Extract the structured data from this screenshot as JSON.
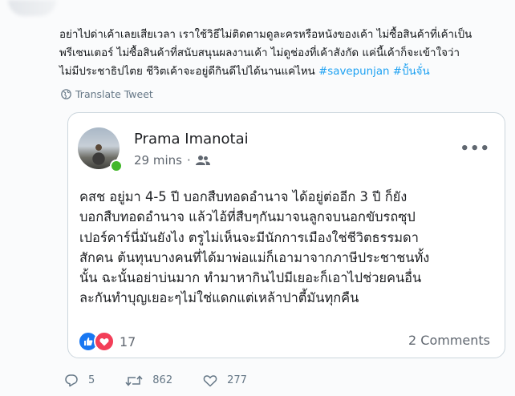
{
  "tweet": {
    "text_line1": "อย่าไปด่าเค้าเลยเสียเวลา เราใช้วิธีไม่ติดตามดูละครหรือหนังของเค้า ไม่ซื้อสินค้าที่เค้าเป็น",
    "text_line2": "พรีเซนเตอร์ ไม่ซื้อสินค้าที่สนับสนุนผลงานเค้า ไม่ดูช่องที่เค้าสังกัด แค่นี้เค้าก็จะเข้าใจว่า",
    "text_line3": "ไม่มีประชาธิปไตย ชีวิตเค้าจะอยู่ดีกินดีไปได้นานแค่ไหน ",
    "hashtag1": "#savepunjan",
    "hashtag2": "#ปั้นจั่น",
    "translate_label": "Translate Tweet"
  },
  "embedded_post": {
    "author": "Prama Imanotai",
    "time": "29 mins",
    "more_label": "•••",
    "body_lines": [
      "คสช อยู่มา 4-5 ปี บอกสืบทอดอำนาจ ได้อยู่ต่ออีก 3 ปี ก็ยัง",
      "บอกสืบทอดอำนาจ แล้วไอ้ที่สืบๆกันมาจนลูกจบนอกขับรถซุป",
      "เปอร์คาร์นี่มันยังไง ตรูไม่เห็นจะมีนักการเมืองใช่ชีวิตธรรมดา",
      "สักคน ต้นทุนบางคนที่ได้มาพ่อแม่ก็เอามาจากภาษีประชาชนทั้ง",
      "นั้น ฉะนั้นอย่าบ่นมาก ทำมาหากินไปมีเยอะก็เอาไปช่วยคนอื่น",
      "ละกันทำบุญเยอะๆไม่ใช่แดกแต่เหล้าปาตี้มันทุกคืน"
    ],
    "reaction_count": "17",
    "comments_label": "2 Comments"
  },
  "actions": {
    "replies": "5",
    "retweets": "862",
    "likes": "277"
  },
  "colors": {
    "link": "#1da1f2",
    "secondary": "#657786",
    "fb_like": "#1877f2",
    "fb_love": "#f33e58",
    "online": "#42b72a"
  }
}
